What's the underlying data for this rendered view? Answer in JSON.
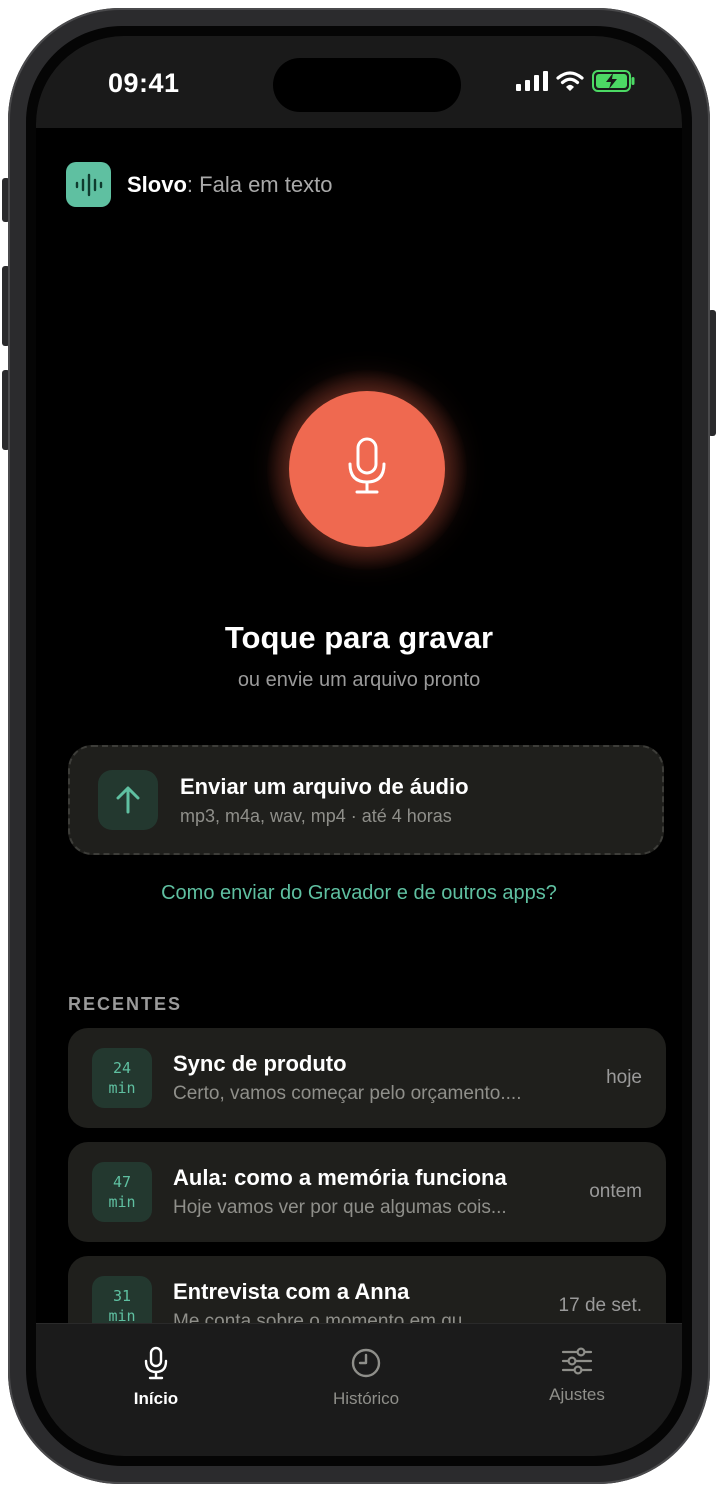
{
  "status": {
    "time": "09:41"
  },
  "app": {
    "name": "Slovo",
    "separator": ":",
    "subtitle": "Fala em texto"
  },
  "record": {
    "title": "Toque para gravar",
    "subtitle": "ou envie um arquivo pronto"
  },
  "upload": {
    "title": "Enviar um arquivo de áudio",
    "formats": "mp3, m4a, wav, mp4 · até 4 horas"
  },
  "help_link": "Como enviar do Gravador e de outros apps?",
  "recents": {
    "label": "RECENTES",
    "items": [
      {
        "duration_value": "24",
        "duration_unit": "min",
        "title": "Sync de produto",
        "preview": "Certo, vamos começar pelo orçamento....",
        "date": "hoje"
      },
      {
        "duration_value": "47",
        "duration_unit": "min",
        "title": "Aula: como a memória funciona",
        "preview": "Hoje vamos ver por que algumas cois...",
        "date": "ontem"
      },
      {
        "duration_value": "31",
        "duration_unit": "min",
        "title": "Entrevista com a Anna",
        "preview": "Me conta sobre o momento em qu...",
        "date": "17 de set."
      }
    ]
  },
  "tabs": [
    {
      "label": "Início",
      "icon": "mic-icon",
      "active": true
    },
    {
      "label": "Histórico",
      "icon": "clock-icon",
      "active": false
    },
    {
      "label": "Ajustes",
      "icon": "sliders-icon",
      "active": false
    }
  ],
  "colors": {
    "accent": "#5fc0a1",
    "record": "#ef6950",
    "background": "#000000",
    "card": "#1f1f1c"
  }
}
